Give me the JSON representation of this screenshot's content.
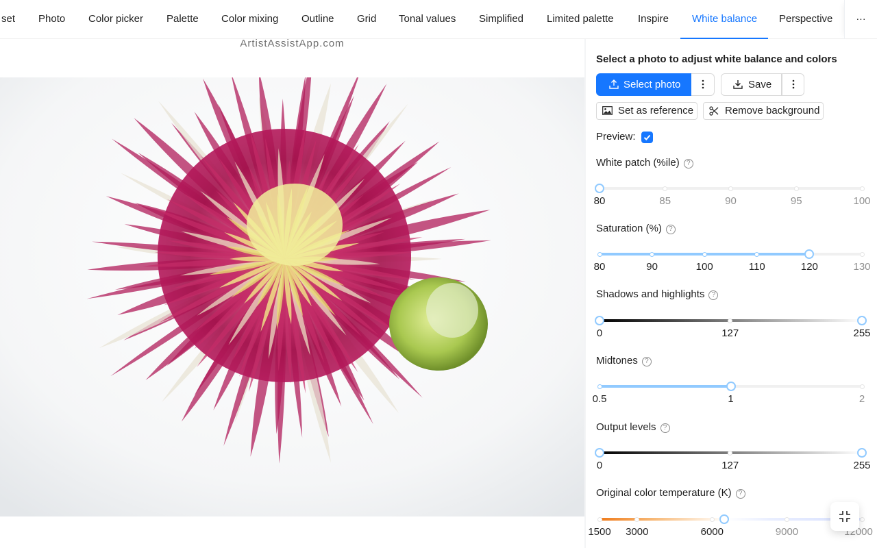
{
  "tabs": [
    {
      "label": "set",
      "active": false
    },
    {
      "label": "Photo",
      "active": false
    },
    {
      "label": "Color picker",
      "active": false
    },
    {
      "label": "Palette",
      "active": false
    },
    {
      "label": "Color mixing",
      "active": false
    },
    {
      "label": "Outline",
      "active": false
    },
    {
      "label": "Grid",
      "active": false
    },
    {
      "label": "Tonal values",
      "active": false
    },
    {
      "label": "Simplified",
      "active": false
    },
    {
      "label": "Limited palette",
      "active": false
    },
    {
      "label": "Inspire",
      "active": false
    },
    {
      "label": "White balance",
      "active": true
    },
    {
      "label": "Perspective",
      "active": false
    }
  ],
  "more_tabs_label": "···",
  "accent_color": "#1677ff",
  "watermark": "ArtistAssistApp.com",
  "panel": {
    "title": "Select a photo to adjust white balance and colors",
    "select_photo": "Select photo",
    "save": "Save",
    "set_as_reference": "Set as reference",
    "remove_background": "Remove background",
    "preview_label": "Preview",
    "preview_checked": true,
    "help_glyph": "?"
  },
  "sliders": {
    "white_patch": {
      "label": "White patch (%ile)",
      "min": 80,
      "max": 100,
      "value": 80,
      "marks": [
        "80",
        "85",
        "90",
        "95",
        "100"
      ]
    },
    "saturation": {
      "label": "Saturation (%)",
      "min": 80,
      "max": 130,
      "value": 120,
      "marks": [
        "80",
        "90",
        "100",
        "110",
        "120",
        "130"
      ]
    },
    "shadows_highlights": {
      "label": "Shadows and highlights",
      "min": 0,
      "max": 255,
      "values": [
        0,
        255
      ],
      "marks": [
        "0",
        "127",
        "255"
      ]
    },
    "midtones": {
      "label": "Midtones",
      "min": 0.5,
      "max": 2,
      "value": 1,
      "marks": [
        "0.5",
        "1",
        "2"
      ]
    },
    "output_levels": {
      "label": "Output levels",
      "min": 0,
      "max": 255,
      "values": [
        0,
        255
      ],
      "marks": [
        "0",
        "127",
        "255"
      ]
    },
    "color_temperature": {
      "label": "Original color temperature (K)",
      "min": 1500,
      "max": 12000,
      "value": 6500,
      "marks": [
        "1500",
        "3000",
        "6000",
        "9000",
        "12000"
      ]
    }
  },
  "icons": {
    "upload": "upload-icon",
    "download": "download-icon",
    "more": "more-vertical-icon",
    "picture": "picture-icon",
    "scissors": "scissors-icon",
    "fullscreen_exit": "fullscreen-exit-icon"
  }
}
